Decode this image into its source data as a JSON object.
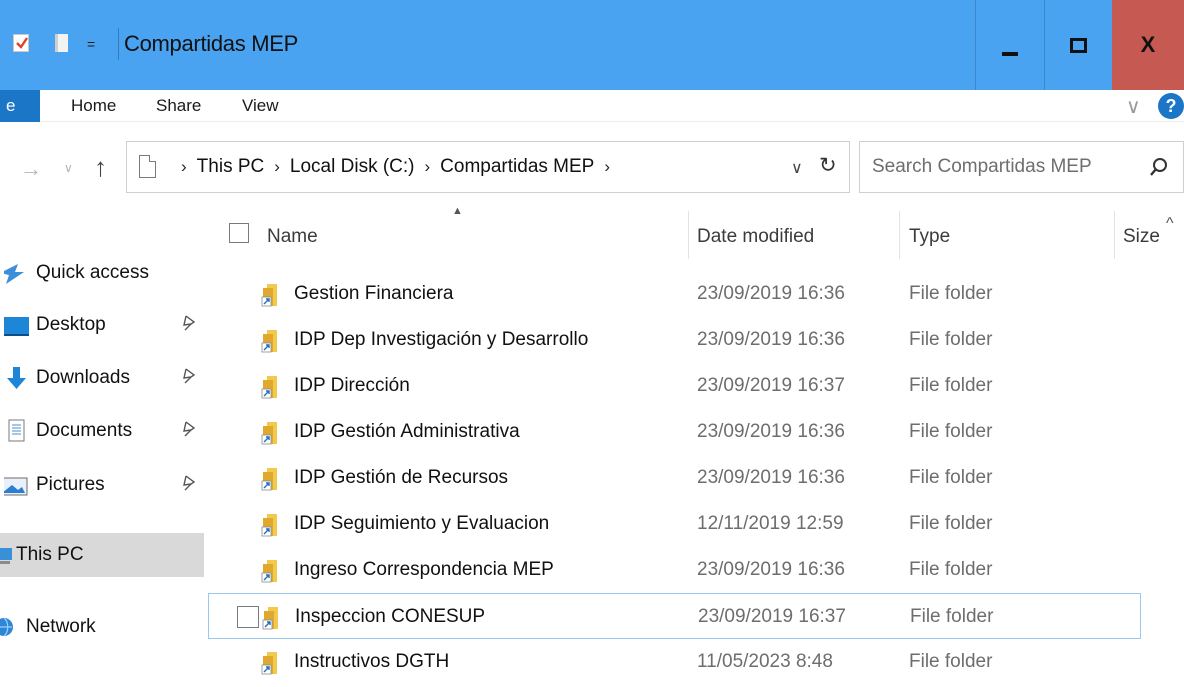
{
  "window": {
    "title": "Compartidas MEP",
    "quick_access_toolbar_dropdown": "=",
    "minimize_label": "",
    "maximize_label": "",
    "close_label": "X",
    "accent_color": "#4aa3f0",
    "close_color": "#c65a52"
  },
  "ribbon": {
    "file_tab": "e",
    "tabs": [
      "Home",
      "Share",
      "View"
    ],
    "expand_glyph": "∨",
    "help_glyph": "?"
  },
  "address_bar": {
    "back_glyph": "→",
    "recent_glyph": "∨",
    "up_glyph": "↑",
    "crumbs": [
      "This PC",
      "Local Disk (C:)",
      "Compartidas MEP"
    ],
    "crumb_separator": "›",
    "dropdown_glyph": "∨",
    "refresh_glyph": "↻"
  },
  "search": {
    "placeholder": "Search Compartidas MEP",
    "value": ""
  },
  "nav_pane": {
    "items": [
      {
        "label": "Quick access",
        "icon": "star-icon",
        "pinned": false
      },
      {
        "label": "Desktop",
        "icon": "desktop-icon",
        "pinned": true
      },
      {
        "label": "Downloads",
        "icon": "download-icon",
        "pinned": true
      },
      {
        "label": "Documents",
        "icon": "document-icon",
        "pinned": true
      },
      {
        "label": "Pictures",
        "icon": "pictures-icon",
        "pinned": true
      },
      {
        "label": "This PC",
        "icon": "computer-icon",
        "pinned": false,
        "selected": true
      },
      {
        "label": "Network",
        "icon": "network-icon",
        "pinned": false
      }
    ],
    "pin_glyph": "📌"
  },
  "file_list": {
    "sort_indicator": "▲",
    "columns": {
      "name": "Name",
      "date_modified": "Date modified",
      "type": "Type",
      "size": "Size"
    },
    "rows": [
      {
        "name": "Gestion Financiera",
        "date": "23/09/2019 16:36",
        "type": "File folder"
      },
      {
        "name": "IDP Dep Investigación y Desarrollo",
        "date": "23/09/2019 16:36",
        "type": "File folder"
      },
      {
        "name": "IDP Dirección",
        "date": "23/09/2019 16:37",
        "type": "File folder"
      },
      {
        "name": "IDP Gestión Administrativa",
        "date": "23/09/2019 16:36",
        "type": "File folder"
      },
      {
        "name": "IDP Gestión de Recursos",
        "date": "23/09/2019 16:36",
        "type": "File folder"
      },
      {
        "name": "IDP Seguimiento y Evaluacion",
        "date": "12/11/2019 12:59",
        "type": "File folder"
      },
      {
        "name": "Ingreso Correspondencia MEP",
        "date": "23/09/2019 16:36",
        "type": "File folder"
      },
      {
        "name": "Inspeccion CONESUP",
        "date": "23/09/2019 16:37",
        "type": "File folder",
        "hovered": true
      },
      {
        "name": "Instructivos DGTH",
        "date": "11/05/2023 8:48",
        "type": "File folder"
      }
    ],
    "scroll_up_glyph": "^"
  }
}
